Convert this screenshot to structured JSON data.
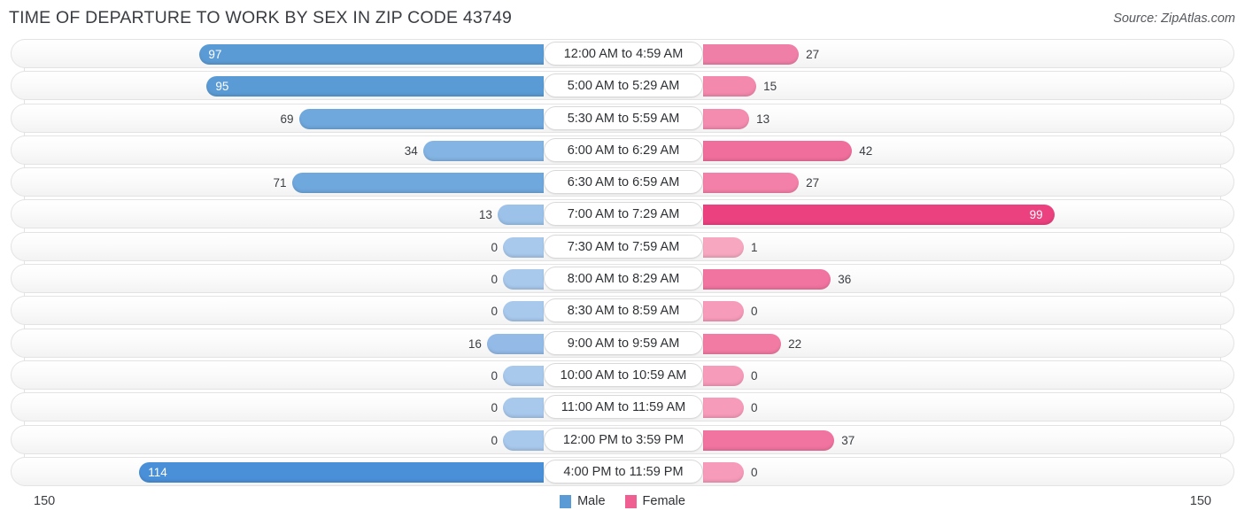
{
  "header": {
    "title": "TIME OF DEPARTURE TO WORK BY SEX IN ZIP CODE 43749",
    "source": "Source: ZipAtlas.com"
  },
  "footer": {
    "axis_left": "150",
    "axis_right": "150",
    "legend": [
      {
        "label": "Male",
        "color": "#5b9bd5"
      },
      {
        "label": "Female",
        "color": "#ef5f92"
      }
    ]
  },
  "chart_data": {
    "type": "bar",
    "subtype": "diverging-bidirectional",
    "title": "TIME OF DEPARTURE TO WORK BY SEX IN ZIP CODE 43749",
    "xlabel": "",
    "ylabel": "",
    "axis_max": 150,
    "grid": false,
    "legend_position": "bottom-center",
    "categories": [
      "12:00 AM to 4:59 AM",
      "5:00 AM to 5:29 AM",
      "5:30 AM to 5:59 AM",
      "6:00 AM to 6:29 AM",
      "6:30 AM to 6:59 AM",
      "7:00 AM to 7:29 AM",
      "7:30 AM to 7:59 AM",
      "8:00 AM to 8:29 AM",
      "8:30 AM to 8:59 AM",
      "9:00 AM to 9:59 AM",
      "10:00 AM to 10:59 AM",
      "11:00 AM to 11:59 AM",
      "12:00 PM to 3:59 PM",
      "4:00 PM to 11:59 PM"
    ],
    "series": [
      {
        "name": "Male",
        "values": [
          97,
          95,
          69,
          34,
          71,
          13,
          0,
          0,
          0,
          16,
          0,
          0,
          0,
          114
        ]
      },
      {
        "name": "Female",
        "values": [
          27,
          15,
          13,
          42,
          27,
          99,
          1,
          36,
          0,
          22,
          0,
          0,
          37,
          0
        ]
      }
    ]
  },
  "rows": [
    {
      "label": "12:00 AM to 4:59 AM",
      "male": "97",
      "female": "27",
      "male_color": "#5b9bd5",
      "female_color": "#f07fa8",
      "male_inside": true,
      "female_inside": false
    },
    {
      "label": "5:00 AM to 5:29 AM",
      "male": "95",
      "female": "15",
      "male_color": "#5b9bd5",
      "female_color": "#f489ae",
      "male_inside": true,
      "female_inside": false
    },
    {
      "label": "5:30 AM to 5:59 AM",
      "male": "69",
      "female": "13",
      "male_color": "#6fa8dd",
      "female_color": "#f48cb0",
      "male_inside": false,
      "female_inside": false
    },
    {
      "label": "6:00 AM to 6:29 AM",
      "male": "34",
      "female": "42",
      "male_color": "#83b4e3",
      "female_color": "#f06e9c",
      "male_inside": false,
      "female_inside": false
    },
    {
      "label": "6:30 AM to 6:59 AM",
      "male": "71",
      "female": "27",
      "male_color": "#6fa8dd",
      "female_color": "#f380a8",
      "male_inside": false,
      "female_inside": false
    },
    {
      "label": "7:00 AM to 7:29 AM",
      "male": "13",
      "female": "99",
      "male_color": "#9cc2ea",
      "female_color": "#ec417f",
      "male_inside": false,
      "female_inside": true
    },
    {
      "label": "7:30 AM to 7:59 AM",
      "male": "0",
      "female": "1",
      "male_color": "#a8c8ec",
      "female_color": "#f7a8c0",
      "male_inside": false,
      "female_inside": false
    },
    {
      "label": "8:00 AM to 8:29 AM",
      "male": "0",
      "female": "36",
      "male_color": "#a8c8ec",
      "female_color": "#f1739f",
      "male_inside": false,
      "female_inside": false
    },
    {
      "label": "8:30 AM to 8:59 AM",
      "male": "0",
      "female": "0",
      "male_color": "#a8c8ec",
      "female_color": "#f79bba",
      "male_inside": false,
      "female_inside": false
    },
    {
      "label": "9:00 AM to 9:59 AM",
      "male": "16",
      "female": "22",
      "male_color": "#94bbe8",
      "female_color": "#f27ba4",
      "male_inside": false,
      "female_inside": false
    },
    {
      "label": "10:00 AM to 10:59 AM",
      "male": "0",
      "female": "0",
      "male_color": "#a8c8ec",
      "female_color": "#f79bba",
      "male_inside": false,
      "female_inside": false
    },
    {
      "label": "11:00 AM to 11:59 AM",
      "male": "0",
      "female": "0",
      "male_color": "#a8c8ec",
      "female_color": "#f79bba",
      "male_inside": false,
      "female_inside": false
    },
    {
      "label": "12:00 PM to 3:59 PM",
      "male": "0",
      "female": "37",
      "male_color": "#a8c8ec",
      "female_color": "#f1739f",
      "male_inside": false,
      "female_inside": false
    },
    {
      "label": "4:00 PM to 11:59 PM",
      "male": "114",
      "female": "0",
      "male_color": "#4a90d9",
      "female_color": "#f79bba",
      "male_inside": true,
      "female_inside": false
    }
  ]
}
